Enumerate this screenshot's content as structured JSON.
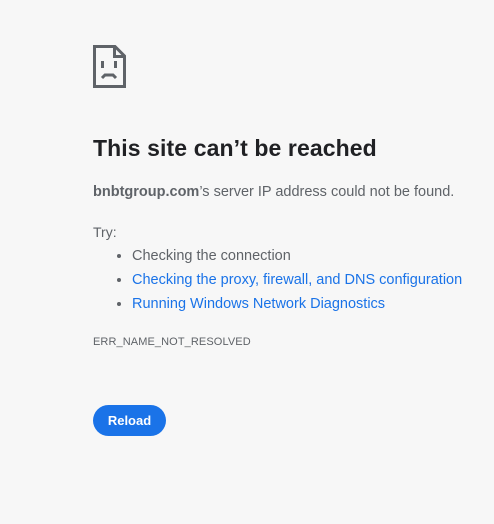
{
  "error": {
    "icon": "sad-page-icon",
    "title": "This site can’t be reached",
    "summary": {
      "domain": "bnbtgroup.com",
      "message": "’s server IP address could not be found."
    },
    "try_label": "Try:",
    "suggestions": [
      {
        "text": "Checking the connection",
        "link": false
      },
      {
        "text": "Checking the proxy, firewall, and DNS configuration",
        "link": true
      },
      {
        "text": "Running Windows Network Diagnostics",
        "link": true
      }
    ],
    "code": "ERR_NAME_NOT_RESOLVED"
  },
  "actions": {
    "reload_label": "Reload"
  },
  "colors": {
    "background": "#f7f7f7",
    "title": "#202124",
    "body_text": "#5f6368",
    "link": "#1a73e8",
    "button": "#1a73e8"
  }
}
